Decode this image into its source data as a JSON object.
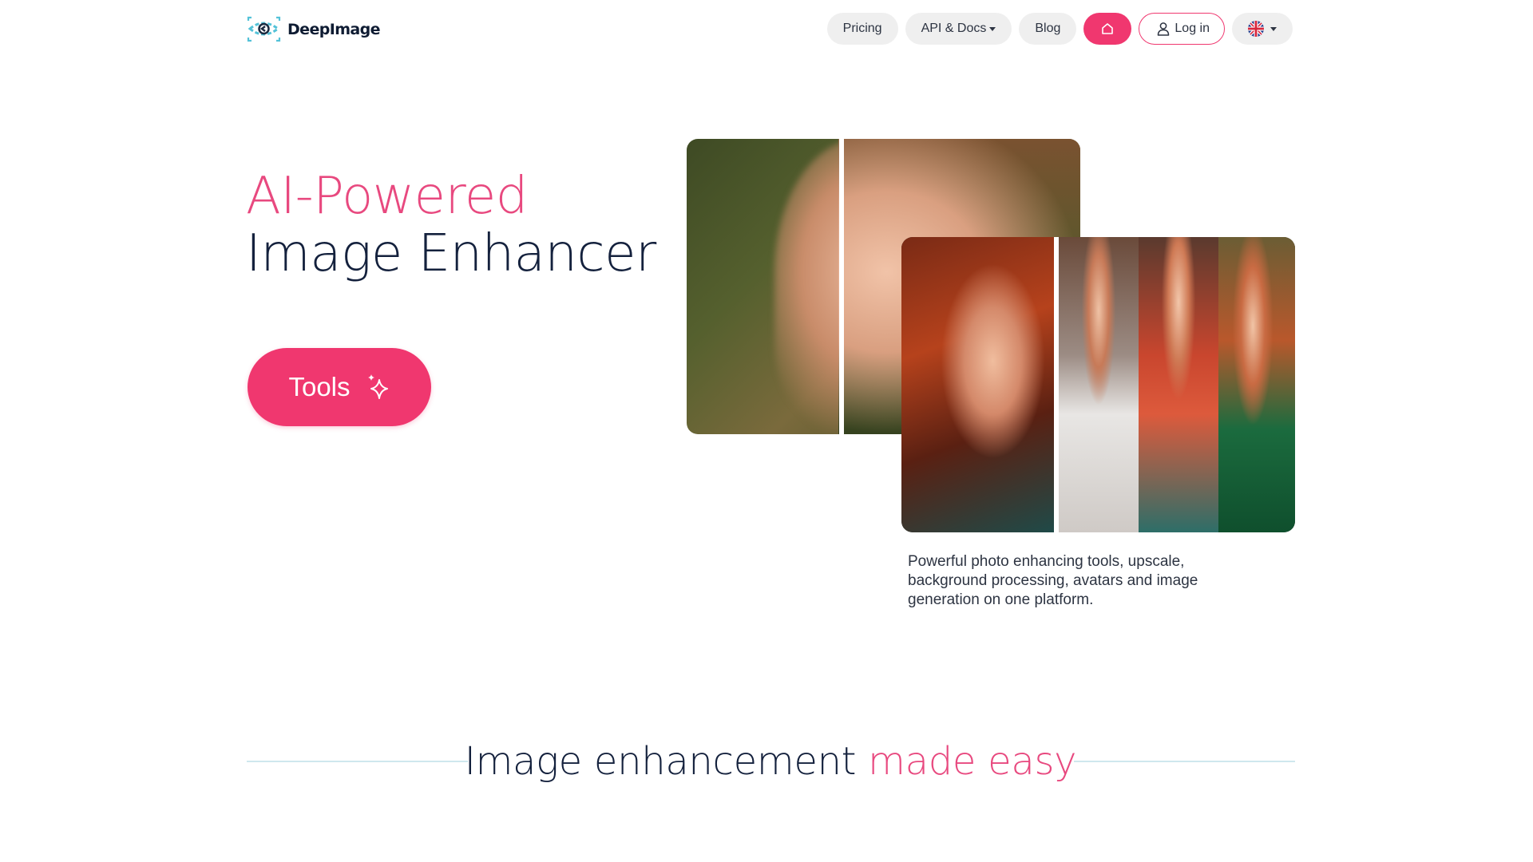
{
  "header": {
    "logo_text": "DeepImage",
    "nav": {
      "pricing": "Pricing",
      "api_docs": "API & Docs",
      "blog": "Blog",
      "home_icon": "home-icon",
      "login": "Log in",
      "language_icon": "uk-flag-icon"
    }
  },
  "hero": {
    "title_line1": "AI-Powered",
    "title_line2": "Image Enhancer",
    "tools_button": "Tools",
    "tools_icon": "sparkles-icon",
    "caption": "Powerful photo enhancing tools, upscale, background processing, avatars and image generation on one platform."
  },
  "section": {
    "title_part1": "Image enhancement ",
    "title_part2": "made easy"
  },
  "colors": {
    "accent": "#f0376f",
    "accent_text": "#e8497f",
    "text_dark": "#14213d",
    "pill_bg": "#efefef",
    "section_line": "#cfe7ee"
  }
}
